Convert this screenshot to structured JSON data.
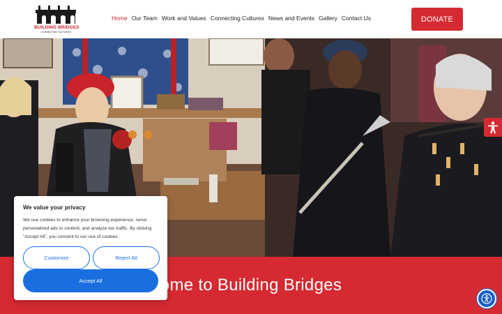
{
  "header": {
    "logo_title": "BUILDING BRIDGES",
    "logo_subtitle": "CONNECTING CULTURES",
    "nav": [
      {
        "label": "Home",
        "active": true
      },
      {
        "label": "Our Team"
      },
      {
        "label": "Work and Values"
      },
      {
        "label": "Connecting Cultures"
      },
      {
        "label": "News and Events"
      },
      {
        "label": "Gallery"
      },
      {
        "label": "Contact Us"
      }
    ],
    "donate_label": "DONATE"
  },
  "hero": {
    "image": "photo of musicians playing bagpipes and singing in a shop",
    "accessibility_tab_icon": "accessibility-person-icon"
  },
  "band": {
    "welcome_text": "ome to Building Bridges"
  },
  "cookie": {
    "title": "We value your privacy",
    "body": "We use cookies to enhance your browsing experience, serve personalized ads or content, and analyze our traffic. By clicking \"Accept All\", you consent to our use of cookies.",
    "customize_label": "Customize",
    "reject_label": "Reject All",
    "accept_label": "Accept All"
  },
  "floating": {
    "accessibility_button_icon": "accessibility-icon"
  },
  "colors": {
    "brand_red": "#d52a31",
    "cookie_blue": "#1a6ee0"
  }
}
